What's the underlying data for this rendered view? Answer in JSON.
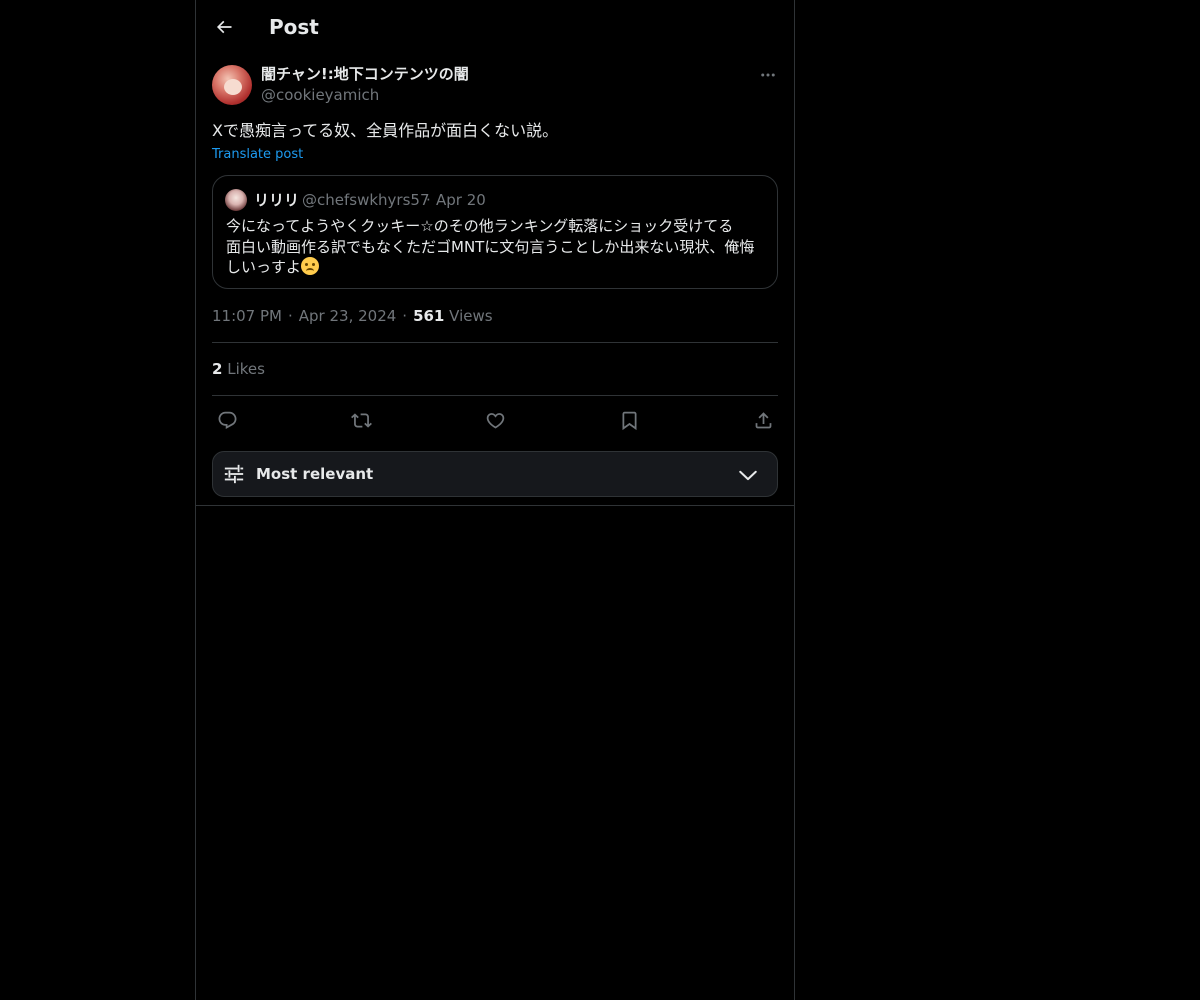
{
  "header": {
    "title": "Post"
  },
  "post": {
    "author": {
      "display_name": "闇チャン!:地下コンテンツの闇",
      "handle": "@cookieyamich"
    },
    "text": "Xで愚痴言ってる奴、全員作品が面白くない説。",
    "translate_label": "Translate post",
    "quoted": {
      "display_name": "リリリ",
      "handle": "@chefswkhyrs57",
      "separator": "·",
      "date": "Apr 20",
      "lines": [
        "今になってようやくクッキー☆のその他ランキング転落にショック受けてる",
        "面白い動画作る訳でもなくただゴMNTに文句言うことしか出来ない現状、俺悔",
        "しいっすよ"
      ],
      "emoji": "sad-but-relieved-face"
    },
    "meta": {
      "time": "11:07 PM",
      "separator": "·",
      "date": "Apr 23, 2024",
      "views_count": "561",
      "views_label": "Views"
    },
    "likes": {
      "count": "2",
      "label": "Likes"
    }
  },
  "actions": {
    "reply": "reply-icon",
    "repost": "repost-icon",
    "like": "heart-icon",
    "bookmark": "bookmark-icon",
    "share": "share-icon"
  },
  "sort": {
    "label": "Most relevant"
  },
  "colors": {
    "background": "#000000",
    "text": "#e7e9ea",
    "muted": "#71767b",
    "link": "#1d9bf0",
    "border": "#2f3336"
  }
}
